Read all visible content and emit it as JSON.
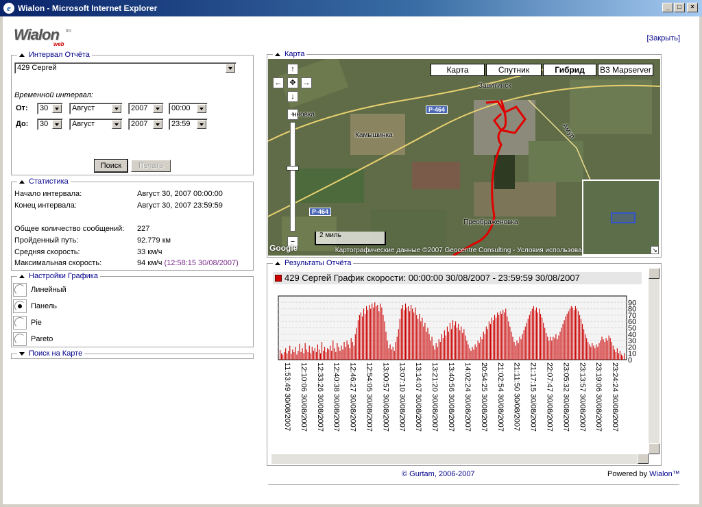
{
  "window": {
    "title": "Wialon - Microsoft Internet Explorer",
    "buttons": [
      "_",
      "□",
      "×"
    ]
  },
  "logo": {
    "main": "Wialon",
    "tm": "tm",
    "sub": "web"
  },
  "close_link": "[Закрыть]",
  "report_interval": {
    "legend": "Интервал Отчёта",
    "unit_select": "429 Сергей",
    "time_interval_label": "Временной интервал:",
    "from": {
      "label": "От:",
      "day": "30",
      "month": "Август",
      "year": "2007",
      "time": "00:00"
    },
    "to": {
      "label": "До:",
      "day": "30",
      "month": "Август",
      "year": "2007",
      "time": "23:59"
    },
    "search_button": "Поиск",
    "print_button": "Печать"
  },
  "statistics": {
    "legend": "Статистика",
    "rows": [
      {
        "label": "Начало интервала:",
        "value": "Август 30, 2007 00:00:00"
      },
      {
        "label": "Конец интервала:",
        "value": "Август 30, 2007 23:59:59"
      },
      {
        "label": "Общее количество сообщений:",
        "value": "227"
      },
      {
        "label": "Пройденный путь:",
        "value": "92.779 км"
      },
      {
        "label": "Средняя скорость:",
        "value": "33 км/ч"
      },
      {
        "label": "Максимальная скорость:",
        "value": "94 км/ч",
        "extra": "(12:58:15 30/08/2007)"
      }
    ]
  },
  "chart_settings": {
    "legend": "Настройки Графика",
    "options": [
      {
        "label": "Линейный",
        "checked": false
      },
      {
        "label": "Панель",
        "checked": true
      },
      {
        "label": "Pie",
        "checked": false
      },
      {
        "label": "Pareto",
        "checked": false
      }
    ]
  },
  "map_search": {
    "legend": "Поиск на Карте"
  },
  "map": {
    "legend": "Карта",
    "tabs": [
      "Карта",
      "Спутник",
      "Гибрид",
      "B3 Mapserver"
    ],
    "active_tab": "Гибрид",
    "labels": [
      "Завитинск",
      "Камышинка",
      "Преображеновка",
      "нновка",
      "Амур"
    ],
    "road_shields": [
      "P-464",
      "P-464"
    ],
    "scale": "2 миль",
    "copyright": "Картографические данные ©2007 Geocentre Consulting - Условия использования",
    "google": "Google",
    "route_color": "#e00000"
  },
  "results": {
    "legend": "Результаты Отчёта",
    "chart_title": "429 Сергей График скорости: 00:00:00 30/08/2007 - 23:59:59 30/08/2007"
  },
  "chart_data": {
    "type": "bar",
    "title": "429 Сергей График скорости: 00:00:00 30/08/2007 - 23:59:59 30/08/2007",
    "ylim": [
      0,
      100
    ],
    "yticks": [
      0,
      10,
      20,
      30,
      40,
      50,
      60,
      70,
      80,
      90
    ],
    "grid": true,
    "bar_color": "#cc0000",
    "x_tick_labels": [
      "11:53:49 30/08/2007",
      "12:10:06 30/08/2007",
      "12:33:26 30/08/2007",
      "12:40:38 30/08/2007",
      "12:46:27 30/08/2007",
      "12:54:05 30/08/2007",
      "13:00:57 30/08/2007",
      "13:07:10 30/08/2007",
      "13:14:07 30/08/2007",
      "13:21:20 30/08/2007",
      "13:40:56 30/08/2007",
      "14:02:24 30/08/2007",
      "20:54:25 30/08/2007",
      "21:02:54 30/08/2007",
      "21:11:50 30/08/2007",
      "21:17:15 30/08/2007",
      "22:07:47 30/08/2007",
      "23:05:32 30/08/2007",
      "23:13:57 30/08/2007",
      "23:19:06 30/08/2007",
      "23:24:24 30/08/2007"
    ],
    "values": [
      15,
      10,
      8,
      12,
      18,
      10,
      14,
      22,
      9,
      16,
      12,
      20,
      8,
      14,
      25,
      12,
      18,
      10,
      26,
      16,
      12,
      22,
      10,
      20,
      14,
      18,
      12,
      24,
      16,
      10,
      28,
      14,
      20,
      12,
      18,
      16,
      22,
      14,
      30,
      18,
      12,
      26,
      20,
      14,
      22,
      16,
      28,
      20,
      30,
      24,
      18,
      34,
      28,
      22,
      40,
      50,
      62,
      70,
      74,
      68,
      80,
      72,
      84,
      78,
      86,
      80,
      88,
      82,
      90,
      84,
      86,
      76,
      88,
      82,
      70,
      60,
      44,
      30,
      18,
      24,
      16,
      20,
      14,
      28,
      36,
      48,
      64,
      80,
      86,
      78,
      88,
      82,
      84,
      76,
      86,
      80,
      74,
      82,
      70,
      64,
      72,
      60,
      66,
      52,
      58,
      44,
      50,
      40,
      30,
      36,
      22,
      16,
      26,
      20,
      32,
      28,
      40,
      34,
      46,
      38,
      52,
      44,
      58,
      48,
      62,
      54,
      60,
      50,
      56,
      46,
      52,
      42,
      48,
      38,
      30,
      24,
      18,
      14,
      20,
      16,
      24,
      20,
      30,
      26,
      36,
      32,
      44,
      40,
      52,
      48,
      60,
      56,
      66,
      62,
      70,
      66,
      74,
      70,
      76,
      72,
      78,
      74,
      80,
      68,
      60,
      52,
      44,
      36,
      28,
      22,
      30,
      26,
      36,
      32,
      40,
      46,
      52,
      58,
      64,
      70,
      76,
      80,
      84,
      78,
      82,
      74,
      80,
      72,
      66,
      58,
      50,
      42,
      36,
      30,
      36,
      30,
      36,
      34,
      40,
      32,
      38,
      44,
      50,
      56,
      62,
      68,
      72,
      76,
      80,
      84,
      82,
      78,
      84,
      80,
      76,
      70,
      64,
      56,
      48,
      40,
      34,
      28,
      24,
      20,
      26,
      22,
      18,
      24,
      20,
      26,
      30,
      36,
      32,
      28,
      34,
      30,
      38,
      34,
      28,
      22,
      16,
      12,
      18,
      10,
      14,
      8,
      6,
      10
    ]
  },
  "footer": {
    "copyright": "© Gurtam, 2006-2007",
    "powered_prefix": "Powered by",
    "powered_brand": "Wialon™"
  }
}
